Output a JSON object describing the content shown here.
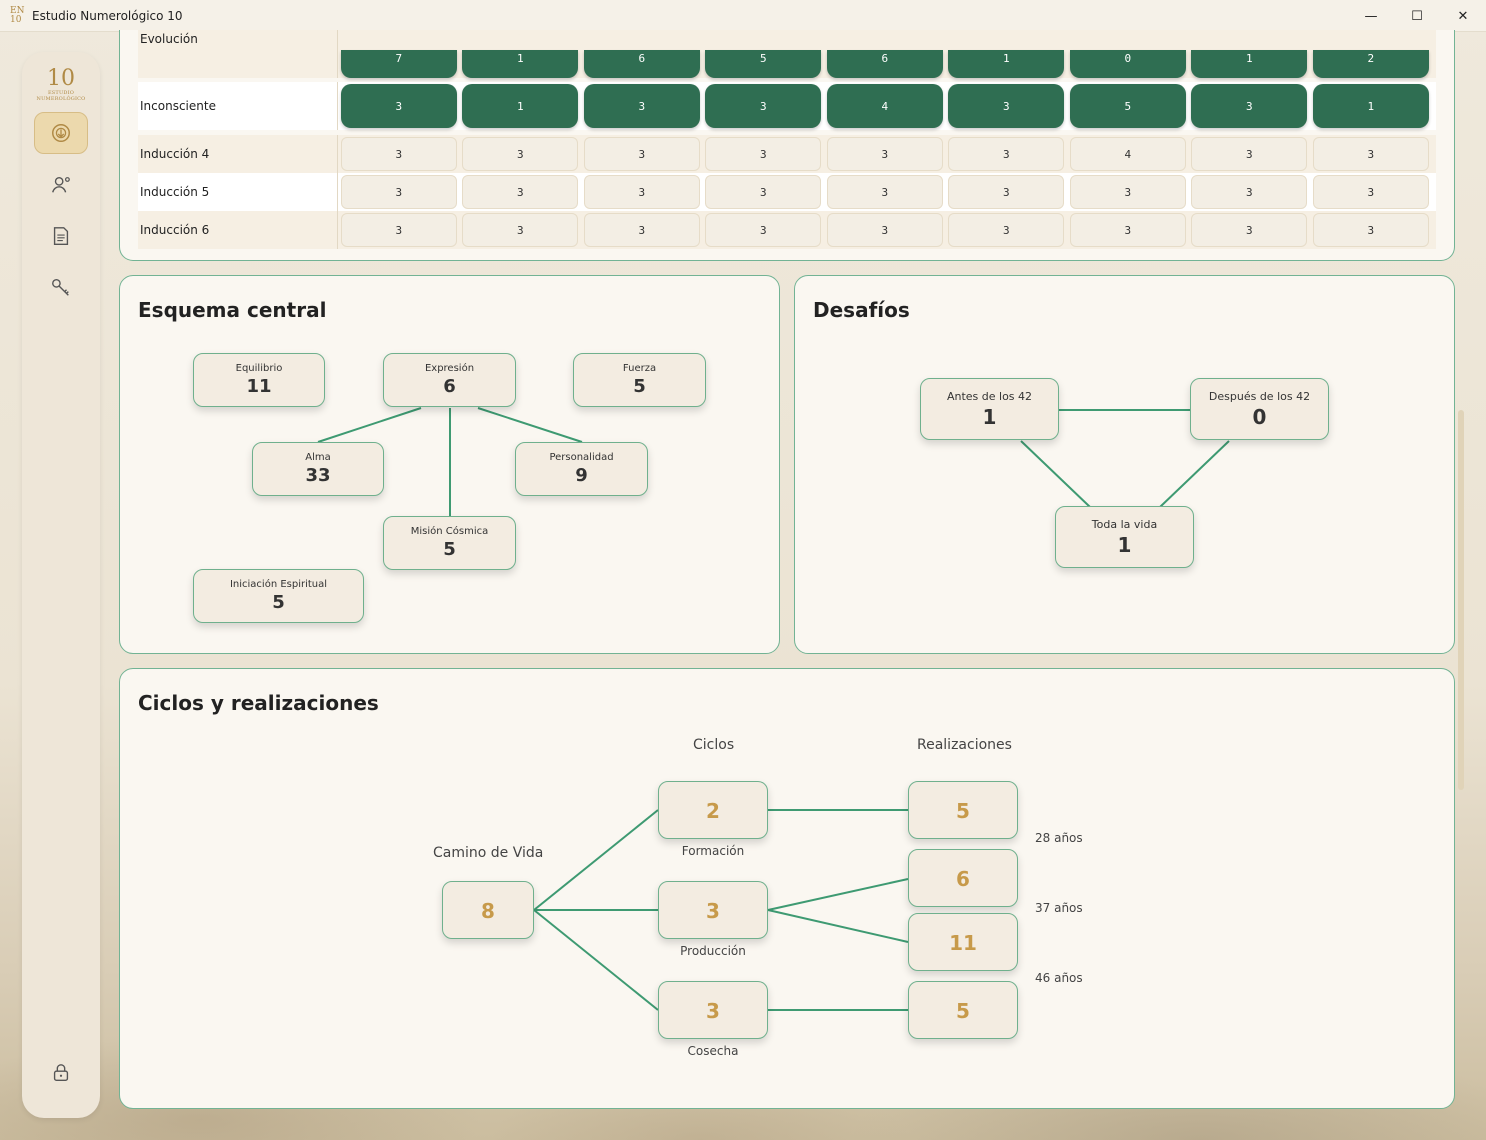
{
  "window": {
    "title": "Estudio Numerológico 10",
    "app_icon": "EN 10",
    "controls": {
      "minimize": "—",
      "maximize": "☐",
      "close": "✕"
    }
  },
  "sidebar": {
    "logo_big": "10",
    "logo_small_1": "ESTUDIO",
    "logo_small_2": "NUMEROLÓGICO",
    "items": [
      {
        "icon": "numerology-icon",
        "active": true
      },
      {
        "icon": "user-add-icon",
        "active": false
      },
      {
        "icon": "document-icon",
        "active": false
      },
      {
        "icon": "key-icon",
        "active": false
      }
    ],
    "bottom_icon": "lock-icon"
  },
  "table": {
    "rows": [
      {
        "label": "Evolución",
        "style": "dark",
        "values": [
          "7",
          "1",
          "6",
          "5",
          "6",
          "1",
          "0",
          "1",
          "2"
        ]
      },
      {
        "label": "Inconsciente",
        "style": "dark",
        "values": [
          "3",
          "1",
          "3",
          "3",
          "4",
          "3",
          "5",
          "3",
          "1"
        ]
      },
      {
        "label": "Inducción 4",
        "style": "light",
        "values": [
          "3",
          "3",
          "3",
          "3",
          "3",
          "3",
          "4",
          "3",
          "3"
        ]
      },
      {
        "label": "Inducción 5",
        "style": "light",
        "values": [
          "3",
          "3",
          "3",
          "3",
          "3",
          "3",
          "3",
          "3",
          "3"
        ]
      },
      {
        "label": "Inducción 6",
        "style": "light",
        "values": [
          "3",
          "3",
          "3",
          "3",
          "3",
          "3",
          "3",
          "3",
          "3"
        ]
      }
    ]
  },
  "esquema": {
    "title": "Esquema central",
    "equilibrio": {
      "label": "Equilibrio",
      "value": "11"
    },
    "expresion": {
      "label": "Expresión",
      "value": "6"
    },
    "fuerza": {
      "label": "Fuerza",
      "value": "5"
    },
    "alma": {
      "label": "Alma",
      "value": "33"
    },
    "personalidad": {
      "label": "Personalidad",
      "value": "9"
    },
    "mision": {
      "label": "Misión Cósmica",
      "value": "5"
    },
    "iniciacion": {
      "label": "Iniciación Espiritual",
      "value": "5"
    }
  },
  "desafios": {
    "title": "Desafíos",
    "antes": {
      "label": "Antes de los 42",
      "value": "1"
    },
    "despues": {
      "label": "Después de los 42",
      "value": "0"
    },
    "toda": {
      "label": "Toda la vida",
      "value": "1"
    }
  },
  "ciclos": {
    "title": "Ciclos y realizaciones",
    "col_ciclos": "Ciclos",
    "col_realizaciones": "Realizaciones",
    "camino_label": "Camino de Vida",
    "camino_value": "8",
    "ciclo_1": {
      "value": "2",
      "label": "Formación"
    },
    "ciclo_2": {
      "value": "3",
      "label": "Producción"
    },
    "ciclo_3": {
      "value": "3",
      "label": "Cosecha"
    },
    "real_1": "5",
    "real_2": "6",
    "real_3": "11",
    "real_4": "5",
    "age_1": "28 años",
    "age_2": "37 años",
    "age_3": "46 años"
  },
  "colors": {
    "accent_green": "#2f6e52",
    "border_green": "#72b394",
    "gold": "#c79a4a"
  }
}
